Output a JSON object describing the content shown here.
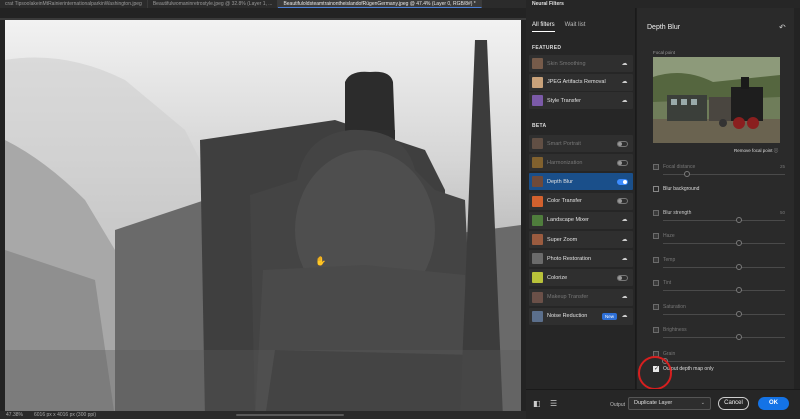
{
  "doc_tabs": [
    {
      "label": "crat TipsoolakeinMtRainierinternationalparkinWashington.jpeg",
      "active": false
    },
    {
      "label": "Beautifulwomaninretrostyle.jpeg @ 32.8% (Layer 1, ...",
      "active": false
    },
    {
      "label": "BeautifuloldsteamtrainontheislandofRügenGermany.jpeg @ 47.4% (Layer 0, RGB/8#) *",
      "active": true
    }
  ],
  "panel_title": "Neural Filters",
  "status": {
    "zoom": "47.38%",
    "doc_size": "6016 px x 4016 px (300 ppi)"
  },
  "filters": {
    "tabs": [
      {
        "label": "All filters",
        "active": true
      },
      {
        "label": "Wait list",
        "active": false
      }
    ],
    "featured_title": "FEATURED",
    "beta_title": "BETA",
    "featured": [
      {
        "label": "Skin Smoothing",
        "control": "cloud",
        "disabled": true,
        "thumb": "#b08060"
      },
      {
        "label": "JPEG Artifacts Removal",
        "control": "cloud",
        "disabled": false,
        "thumb": "#c9a27a"
      },
      {
        "label": "Style Transfer",
        "control": "cloud",
        "disabled": false,
        "thumb": "#7b5aa8"
      }
    ],
    "beta": [
      {
        "label": "Smart Portrait",
        "control": "toggle-off",
        "disabled": true,
        "thumb": "#8a6a55"
      },
      {
        "label": "Harmonization",
        "control": "toggle-off",
        "disabled": true,
        "thumb": "#c58a2d"
      },
      {
        "label": "Depth Blur",
        "control": "toggle-on",
        "disabled": false,
        "selected": true,
        "thumb": "#6f4a3a"
      },
      {
        "label": "Color Transfer",
        "control": "toggle-off",
        "disabled": false,
        "thumb": "#d2612e"
      },
      {
        "label": "Landscape Mixer",
        "control": "cloud",
        "disabled": false,
        "thumb": "#4f7d3c"
      },
      {
        "label": "Super Zoom",
        "control": "cloud",
        "disabled": false,
        "thumb": "#9a5b3f"
      },
      {
        "label": "Photo Restoration",
        "control": "cloud",
        "disabled": false,
        "thumb": "#6b6b6b"
      },
      {
        "label": "Colorize",
        "control": "toggle-off",
        "disabled": false,
        "thumb": "#b9c23a"
      },
      {
        "label": "Makeup Transfer",
        "control": "cloud",
        "disabled": true,
        "thumb": "#9d6b5c"
      },
      {
        "label": "Noise Reduction",
        "control": "badge",
        "badge": "New",
        "disabled": false,
        "thumb": "#5b6f8c"
      }
    ]
  },
  "settings": {
    "title": "Depth Blur",
    "focal_point_label": "Focal point",
    "remove_focal": "Remove focal point",
    "focal_distance": {
      "label": "Focal distance",
      "value": "25",
      "level": 0.2
    },
    "blur_background_label": "Blur background",
    "blur_strength": {
      "label": "Blur strength",
      "value": "50",
      "level": 0.62
    },
    "sliders": [
      {
        "label": "Haze",
        "level": 0.62
      },
      {
        "label": "Temp",
        "level": 0.62
      },
      {
        "label": "Tint",
        "level": 0.62
      },
      {
        "label": "Saturation",
        "level": 0.62
      },
      {
        "label": "Brightness",
        "level": 0.62
      },
      {
        "label": "Grain",
        "level": 0.02
      }
    ],
    "output_depth_label": "Output depth map only",
    "output_depth_checked": true
  },
  "bottom": {
    "output_label": "Output",
    "output_value": "Duplicate Layer",
    "cancel": "Cancel",
    "ok": "OK"
  }
}
